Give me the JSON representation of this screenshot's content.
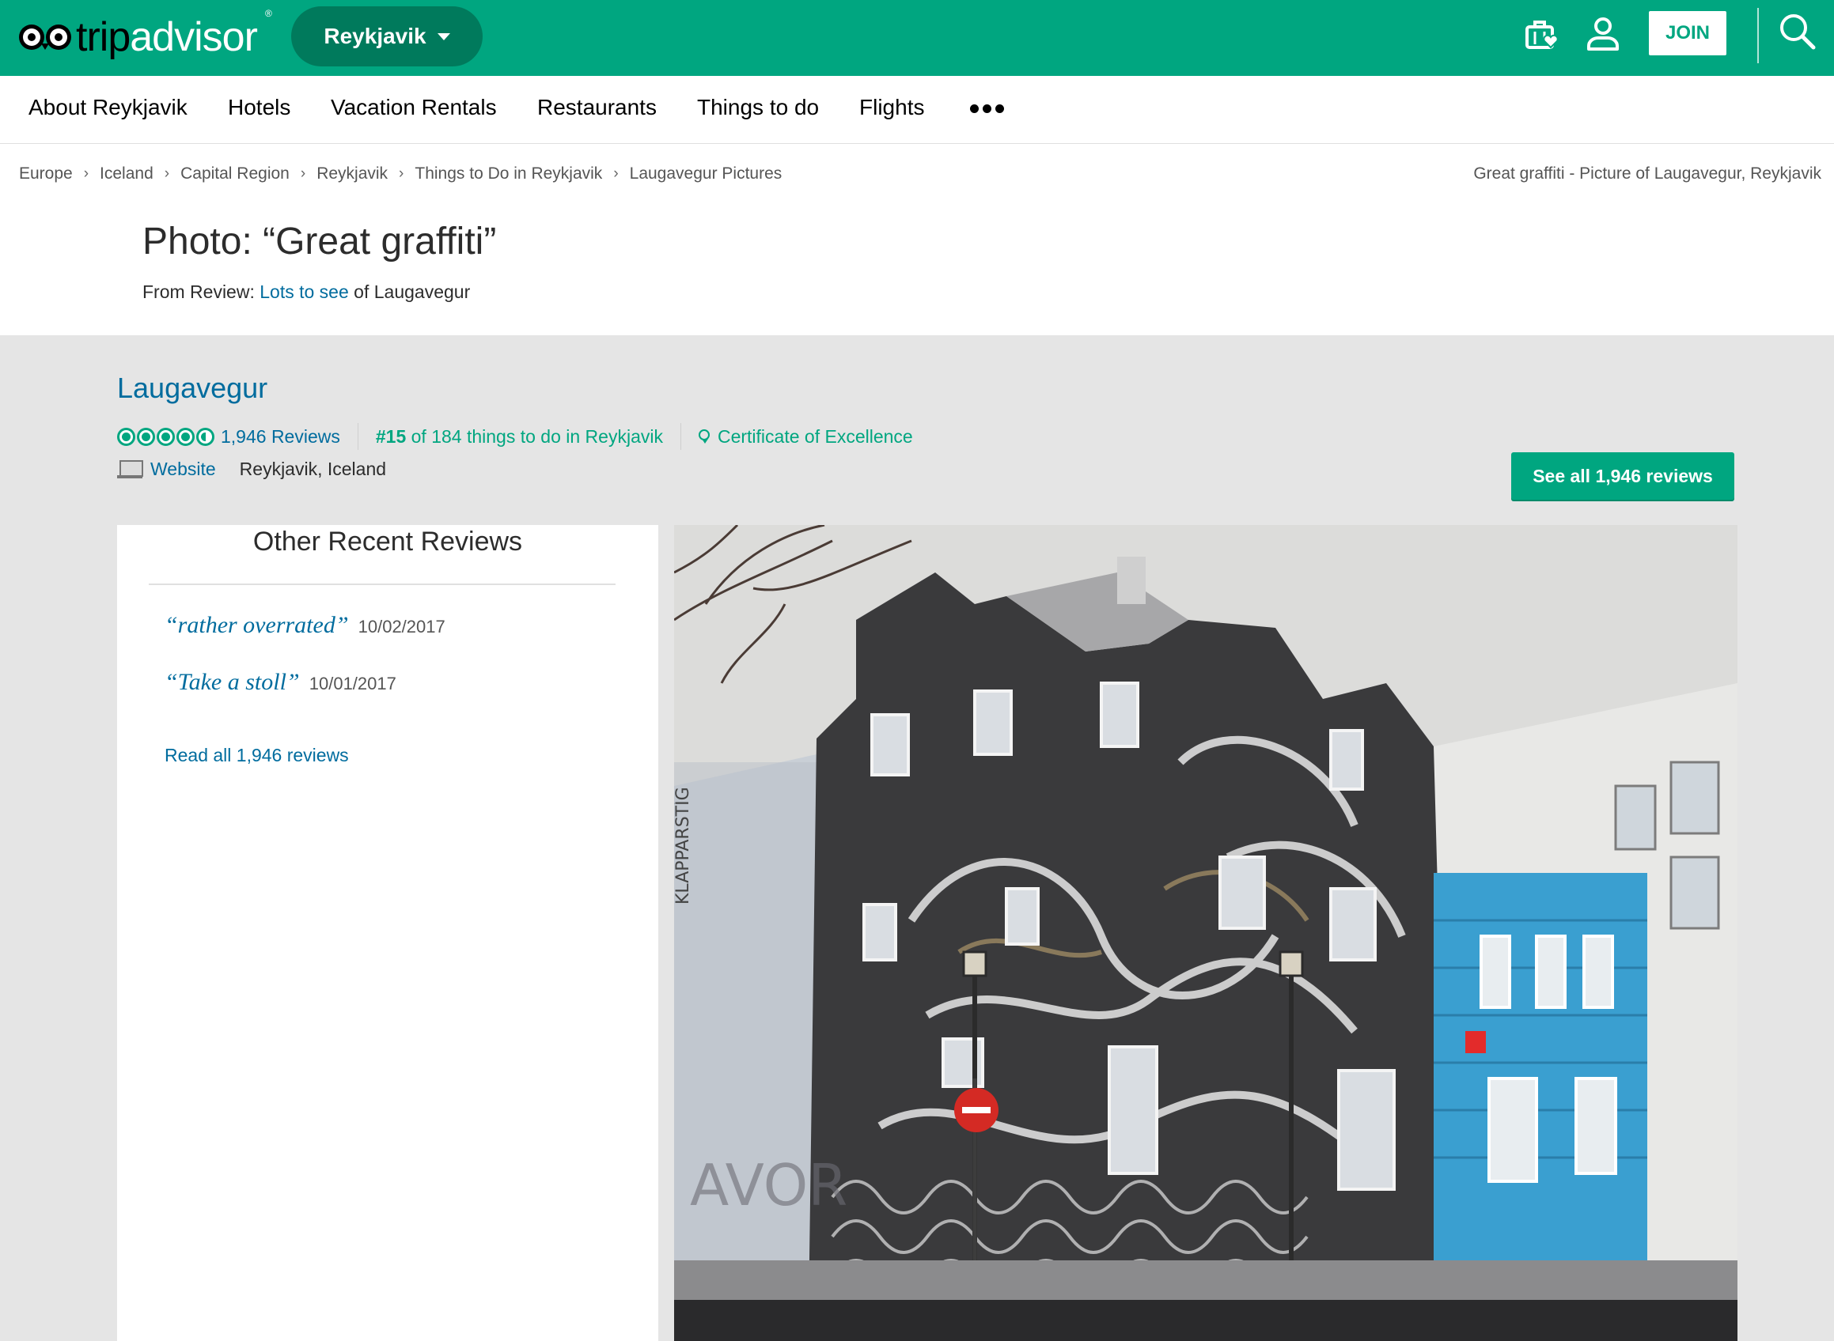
{
  "header": {
    "logo_text_trip": "trip",
    "logo_text_advisor": "advisor",
    "logo_reg": "®",
    "geo_label": "Reykjavik",
    "join_label": "JOIN",
    "icons": [
      "trips-briefcase-heart-icon",
      "user-profile-icon",
      "search-icon"
    ],
    "brand_color": "#00a680"
  },
  "nav": {
    "items": [
      "About Reykjavik",
      "Hotels",
      "Vacation Rentals",
      "Restaurants",
      "Things to do",
      "Flights"
    ],
    "more_icon": "more-dots-icon"
  },
  "breadcrumbs": {
    "items": [
      "Europe",
      "Iceland",
      "Capital Region",
      "Reykjavik",
      "Things to Do in Reykjavik",
      "Laugavegur Pictures"
    ],
    "separator": "›",
    "right_text": "Great graffiti - Picture of Laugavegur, Reykjavik"
  },
  "photo_header": {
    "title": "Photo: “Great graffiti”",
    "from_prefix": "From Review: ",
    "review_link": "Lots to see",
    "from_suffix": " of Laugavegur"
  },
  "poi": {
    "name": "Laugavegur",
    "rating": 4.5,
    "reviews_link": "1,946 Reviews",
    "rank_prefix": "#15",
    "rank_text": " of 184 things to do in Reykjavik",
    "certificate": "Certificate of Excellence",
    "website_label": "Website",
    "address": "Reykjavik, Iceland",
    "see_all_label": "See all 1,946 reviews"
  },
  "recent_reviews": {
    "title": "Other Recent Reviews",
    "items": [
      {
        "title": "“rather overrated”",
        "date": "10/02/2017"
      },
      {
        "title": "“Take a stoll”",
        "date": "10/01/2017"
      }
    ],
    "read_all": "Read all 1,946 reviews"
  },
  "photo": {
    "street_sign_text": "KLAPPARSTÍG",
    "graffiti_text": "AVOR",
    "accent_blue": "#3a9fd0"
  }
}
